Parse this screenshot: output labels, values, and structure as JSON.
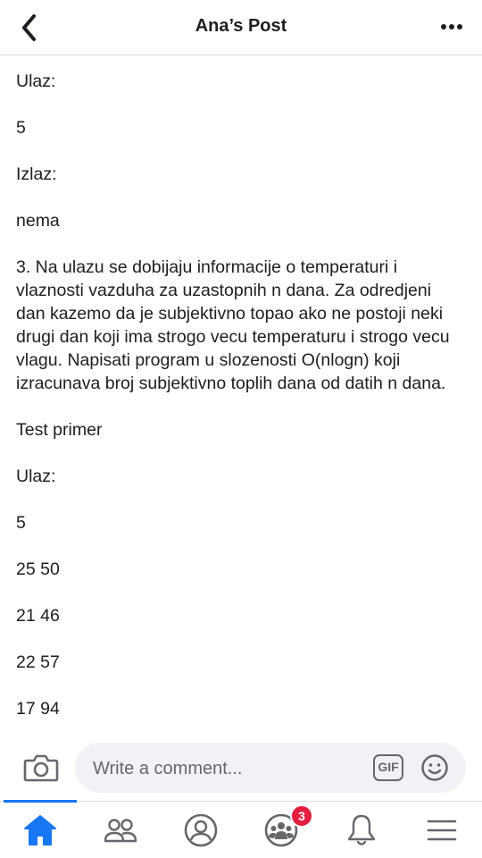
{
  "header": {
    "title": "Ana’s Post"
  },
  "post": {
    "paragraphs": [
      "Ulaz:",
      "5",
      "Izlaz:",
      "nema",
      "3. Na ulazu se dobijaju informacije o temperaturi i vlaznosti vazduha za uzastopnih n dana. Za odredjeni dan kazemo da je subjektivno topao ako ne postoji neki drugi dan koji ima strogo vecu temperaturu i strogo vecu vlagu. Napisati program u slozenosti O(nlogn) koji izracunava broj subjektivno toplih dana od datih n dana.",
      "Test primer",
      "Ulaz:",
      "5",
      "25 50",
      "21 46",
      "22 57",
      "17 94"
    ]
  },
  "comment_bar": {
    "placeholder": "Write a comment...",
    "gif_label": "GIF"
  },
  "tab_bar": {
    "tabs": [
      {
        "icon": "home-icon",
        "active": true
      },
      {
        "icon": "friends-icon",
        "active": false
      },
      {
        "icon": "profile-icon",
        "active": false
      },
      {
        "icon": "groups-icon",
        "active": false,
        "badge": "3"
      },
      {
        "icon": "bell-icon",
        "active": false
      },
      {
        "icon": "menu-icon",
        "active": false
      }
    ],
    "groups_badge": "3"
  },
  "colors": {
    "accent": "#1877f2",
    "icon_gray": "#65676b",
    "badge_red": "#e41e3f",
    "text": "#1c1e21"
  }
}
